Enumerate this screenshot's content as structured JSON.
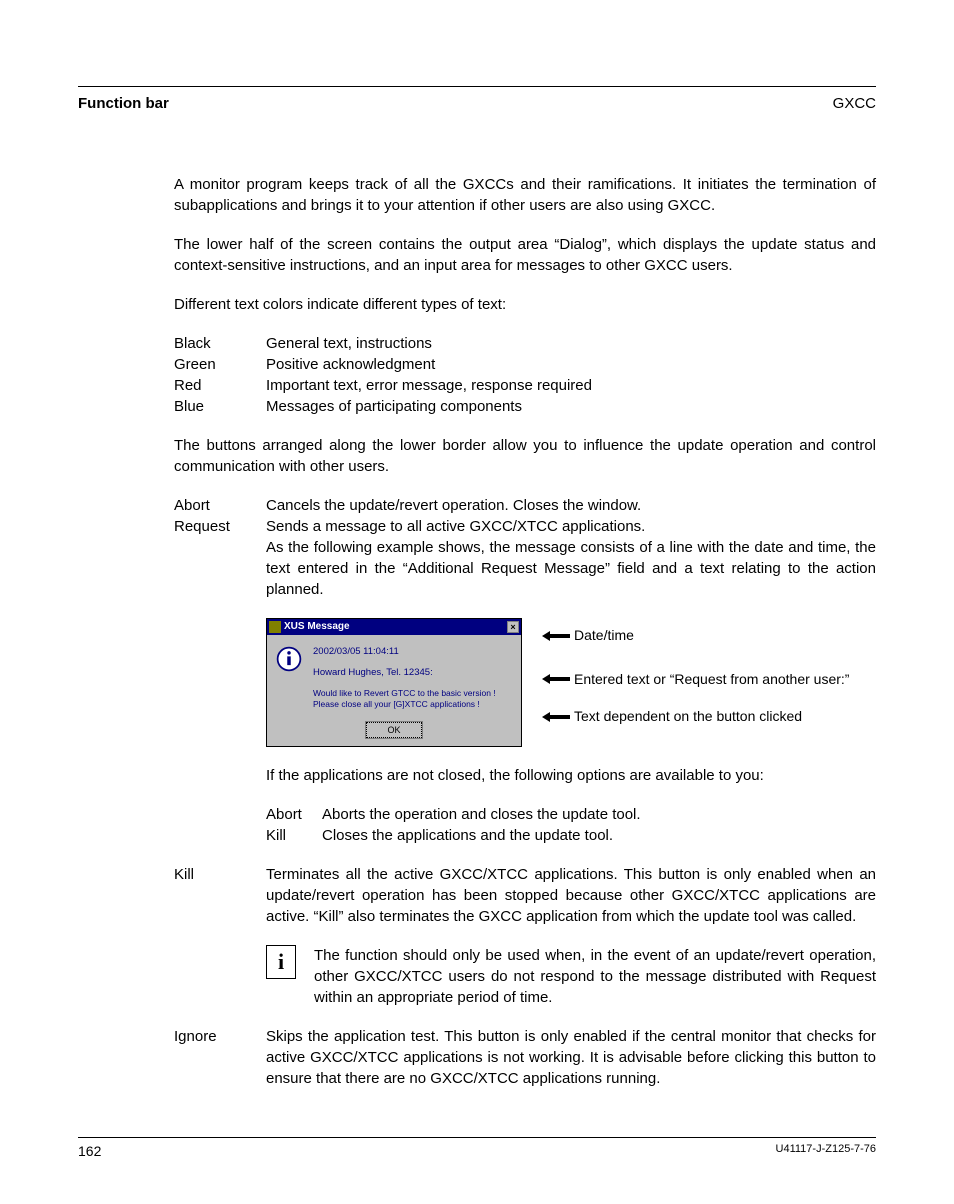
{
  "header": {
    "left": "Function bar",
    "right": "GXCC"
  },
  "paragraphs": {
    "p1": "A monitor program keeps track of all the GXCCs and their ramifications. It initiates the termination of subapplications and brings it to your attention if other users are also using GXCC.",
    "p2": "The lower half of the screen contains the output area “Dialog”, which displays the update status and context-sensitive instructions, and an input area for messages to other GXCC users.",
    "p3": "Different text colors indicate different types of text:",
    "p4": "The buttons arranged along the lower border allow you to influence the update operation and control communication with other users.",
    "p5": "If the applications are not closed, the following options are available to you:"
  },
  "colors": [
    {
      "label": "Black",
      "desc": "General text, instructions"
    },
    {
      "label": "Green",
      "desc": "Positive acknowledgment"
    },
    {
      "label": "Red",
      "desc": "Important text, error message, response required"
    },
    {
      "label": "Blue",
      "desc": "Messages of participating components"
    }
  ],
  "buttons": {
    "abort": {
      "label": "Abort",
      "desc": "Cancels the update/revert operation. Closes the window."
    },
    "request": {
      "label": "Request",
      "desc1": "Sends a message to all active GXCC/XTCC applications.",
      "desc2": "As the following example shows, the message consists of a line with the date and time, the text entered in the “Additional Request Message” field and a text relating to the action planned."
    },
    "kill": {
      "label": "Kill",
      "desc": "Terminates all the active GXCC/XTCC applications. This button is only enabled when an update/revert operation has been stopped because other GXCC/XTCC applications are active. “Kill” also terminates the GXCC application from which the update tool was called."
    },
    "ignore": {
      "label": "Ignore",
      "desc": "Skips the application test. This button is only enabled if the central monitor that checks for active GXCC/XTCC applications is not working. It is advisable before clicking this button to ensure that there are no GXCC/XTCC applications running."
    }
  },
  "dialog": {
    "title": "XUS Message",
    "datetime": "2002/03/05 11:04:11",
    "entered": "Howard Hughes, Tel. 12345:",
    "action1": "Would like to Revert GTCC to the basic version !",
    "action2": "Please close all your [G]XTCC applications !",
    "ok": "OK"
  },
  "annotations": {
    "a1": "Date/time",
    "a2": "Entered text or “Request from another user:”",
    "a3": "Text dependent on the button clicked"
  },
  "suboptions": [
    {
      "label": "Abort",
      "desc": "Aborts the operation and closes the update tool."
    },
    {
      "label": "Kill",
      "desc": "Closes the applications and the update tool."
    }
  ],
  "infobox": {
    "icon": "i",
    "text": "The function should only be used when, in the event of an update/revert operation, other GXCC/XTCC users do not respond to the message distributed with Request within an appropriate period of time."
  },
  "footer": {
    "page": "162",
    "docid": "U41117-J-Z125-7-76"
  }
}
